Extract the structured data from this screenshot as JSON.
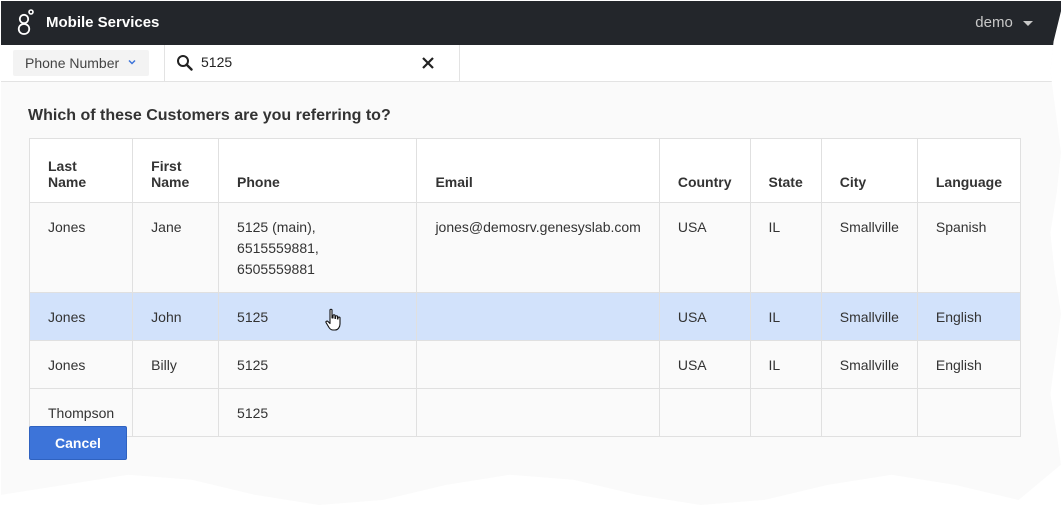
{
  "header": {
    "app_title": "Mobile Services",
    "user_label": "demo"
  },
  "search": {
    "type_label": "Phone Number",
    "value": "5125"
  },
  "main": {
    "question": "Which of these Customers are you referring to?"
  },
  "table": {
    "columns": [
      "Last Name",
      "First Name",
      "Phone",
      "Email",
      "Country",
      "State",
      "City",
      "Language"
    ],
    "rows": [
      [
        "Jones",
        "Jane",
        "5125 (main), 6515559881, 6505559881",
        "jones@demosrv.genesyslab.com",
        "USA",
        "IL",
        "Smallville",
        "Spanish"
      ],
      [
        "Jones",
        "John",
        "5125",
        "",
        "USA",
        "IL",
        "Smallville",
        "English"
      ],
      [
        "Jones",
        "Billy",
        "5125",
        "",
        "USA",
        "IL",
        "Smallville",
        "English"
      ],
      [
        "Thompson",
        "",
        "5125",
        "",
        "",
        "",
        "",
        ""
      ]
    ],
    "selected_row_index": 1
  },
  "actions": {
    "cancel_label": "Cancel"
  },
  "colors": {
    "topbar": "#23262b",
    "accent": "#3d74d9",
    "selected_row": "#d2e2fb"
  },
  "icons": [
    "genesys-logo-icon",
    "chevron-down-icon",
    "search-icon",
    "close-icon",
    "hand-cursor-icon"
  ]
}
